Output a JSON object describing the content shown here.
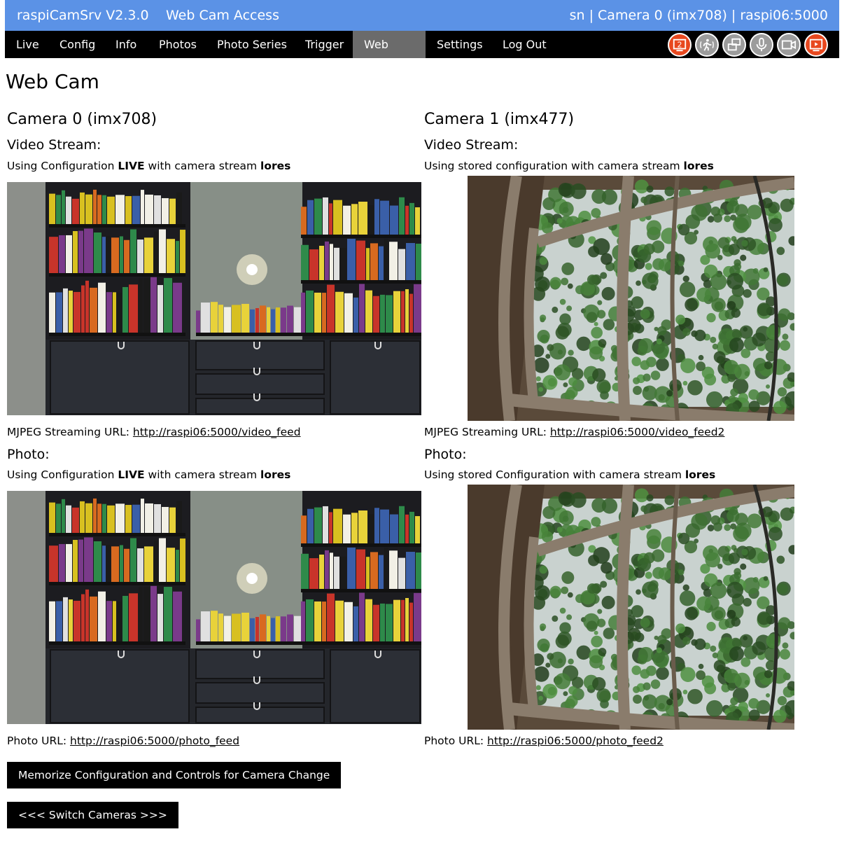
{
  "header": {
    "app_title": "raspiCamSrv V2.3.0",
    "subtitle": "Web Cam Access",
    "status": "sn | Camera 0 (imx708) | raspi06:5000"
  },
  "nav": {
    "items": [
      "Live",
      "Config",
      "Info",
      "Photos",
      "Photo Series",
      "Trigger",
      "Web Cam",
      "Settings",
      "Log Out"
    ],
    "active": "Web Cam"
  },
  "status_icons": [
    {
      "name": "camera-2-icon",
      "label": "2",
      "color": "#e8481f"
    },
    {
      "name": "motion-trigger-icon",
      "color": "#9c9c9c"
    },
    {
      "name": "multi-window-icon",
      "color": "#9c9c9c"
    },
    {
      "name": "microphone-icon",
      "color": "#9c9c9c"
    },
    {
      "name": "video-camera-icon",
      "color": "#9c9c9c"
    },
    {
      "name": "video-playing-icon",
      "color": "#e8481f"
    }
  ],
  "page_title": "Web Cam",
  "cameras": [
    {
      "title": "Camera 0 (imx708)",
      "video_heading": "Video Stream:",
      "video_info": {
        "prefix": "Using Configuration ",
        "config": "LIVE",
        "middle": " with camera stream ",
        "stream": "lores"
      },
      "video_url_label": "MJPEG Streaming URL: ",
      "video_url": "http://raspi06:5000/video_feed",
      "photo_heading": "Photo:",
      "photo_info": {
        "prefix": "Using Configuration ",
        "config": "LIVE",
        "middle": " with camera stream ",
        "stream": "lores"
      },
      "photo_url_label": "Photo URL: ",
      "photo_url": "http://raspi06:5000/photo_feed",
      "scene": "bookshelf"
    },
    {
      "title": "Camera 1 (imx477)",
      "video_heading": "Video Stream:",
      "video_info": {
        "prefix": "Using stored configuration with camera stream ",
        "config": "",
        "middle": "",
        "stream": "lores"
      },
      "video_url_label": "MJPEG Streaming URL: ",
      "video_url": "http://raspi06:5000/video_feed2",
      "photo_heading": "Photo:",
      "photo_info": {
        "prefix": "Using stored Configuration with camera stream ",
        "config": "",
        "middle": "",
        "stream": "lores"
      },
      "photo_url_label": "Photo URL: ",
      "photo_url": "http://raspi06:5000/photo_feed2",
      "scene": "window"
    }
  ],
  "buttons": {
    "memorize": "Memorize Configuration and Controls for Camera Change",
    "switch": "<<< Switch Cameras >>>"
  }
}
